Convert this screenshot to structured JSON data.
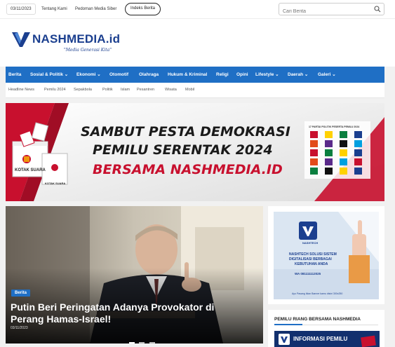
{
  "topbar": {
    "date": "03/11/2023",
    "links": [
      "Tentang Kami",
      "Pedoman Media Siber"
    ],
    "indeks_label": "Indeks Berita",
    "search_placeholder": "Cari Berita"
  },
  "logo": {
    "name": "NASHMEDIA.id",
    "tagline": "\"Media Generasi Kita\""
  },
  "nav": {
    "items": [
      {
        "label": "Berita"
      },
      {
        "label": "Sosial & Politik ⌄"
      },
      {
        "label": "Ekonomi ⌄"
      },
      {
        "label": "Otomotif"
      },
      {
        "label": "Olahraga"
      },
      {
        "label": "Hukum & Kriminal"
      },
      {
        "label": "Religi"
      },
      {
        "label": "Opini"
      },
      {
        "label": "Lifestyle ⌄"
      },
      {
        "label": "Daerah ⌄"
      },
      {
        "label": "Galeri ⌄"
      }
    ]
  },
  "subnav": {
    "items": [
      "Headline News",
      "Pemilu 2024",
      "Sepakbola",
      "Politik",
      "Islam",
      "Pesantren",
      "Wisata",
      "Mobil"
    ]
  },
  "banner": {
    "line1": "SAMBUT PESTA DEMOKRASI",
    "line2": "PEMILU SERENTAK 2024",
    "line3": "BERSAMA NASHMEDIA.ID",
    "box_label": "KOTAK SUARA",
    "parties_title": "17 PARTAI POLITIK PESERTA PEMILU 2024"
  },
  "hero": {
    "category": "Berita",
    "title_line1": "Putin Beri Peringatan Adanya Provokator di",
    "title_line2": "Perang Hamas-Israel!",
    "date": "03/11/2023",
    "slides": 3,
    "active_slide": 1
  },
  "side_ad": {
    "brand": "NASHTECH",
    "text_line1": "NASHTECH SOLUSI SISTEM",
    "text_line2": "DIGITALISASI BERBAGAI",
    "text_line3": "KEBUTUHAN ANDA",
    "phone": "WA 081111112025",
    "caption": "Ayo Pasang Iklan Banner kamu disini 300x250"
  },
  "widget": {
    "title": "PEMILU RIANG BERSAMA NASHMEDIA",
    "thumb_text": "INFORMASI PEMILU"
  },
  "colors": {
    "brand_blue": "#1f6fc5",
    "logo_navy": "#1b3f8f",
    "banner_red": "#c8102e"
  }
}
